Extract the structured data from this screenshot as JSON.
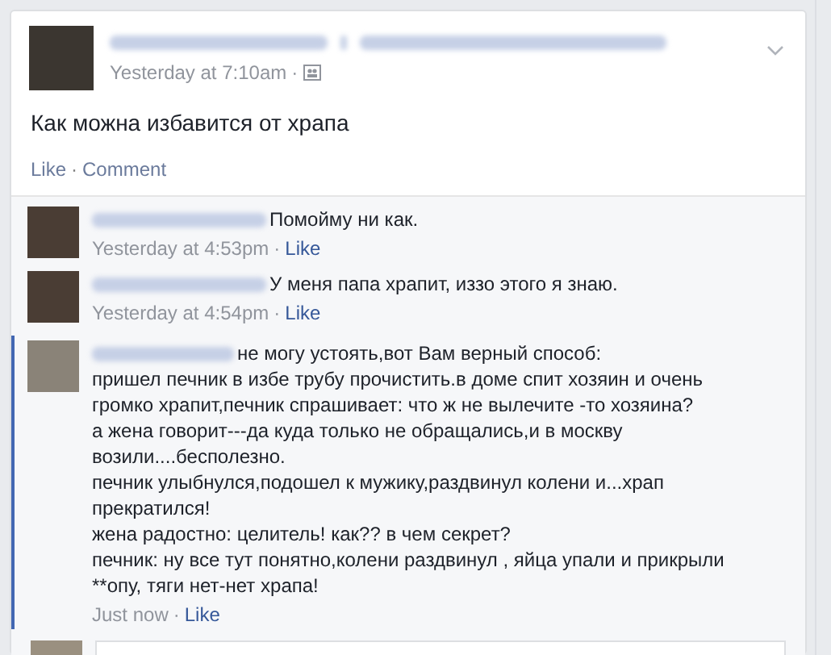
{
  "post": {
    "time": "Yesterday at 7:10am",
    "separator": "·",
    "text": "Как можна избавится от храпа",
    "actions": [
      {
        "label": "Like"
      },
      {
        "label": "Comment"
      }
    ]
  },
  "comments": [
    {
      "paragraphs": [
        "Помойму ни как."
      ],
      "time": "Yesterday at 4:53pm",
      "action": "Like",
      "highlighted": false
    },
    {
      "paragraphs": [
        "У меня папа храпит, иззо этого я знаю."
      ],
      "time": "Yesterday at 4:54pm",
      "action": "Like",
      "highlighted": false
    },
    {
      "paragraphs": [
        "не могу устоять,вот Вам верный способ:",
        "пришел печник в избе трубу прочистить.в доме спит хозяин и очень громко храпит,печник спрашивает: что ж не вылечите -то хозяина?",
        "а жена говорит---да куда только не обращались,и в москву возили....бесполезно.",
        "печник улыбнулся,подошел к мужику,раздвинул колени и...храп прекратился!",
        "жена радостно: целитель! как?? в чем секрет?",
        "печник: ну все тут понятно,колени раздвинул , яйца упали и прикрыли **опу, тяги нет-нет храпа!"
      ],
      "time": "Just now",
      "action": "Like",
      "highlighted": true
    }
  ]
}
